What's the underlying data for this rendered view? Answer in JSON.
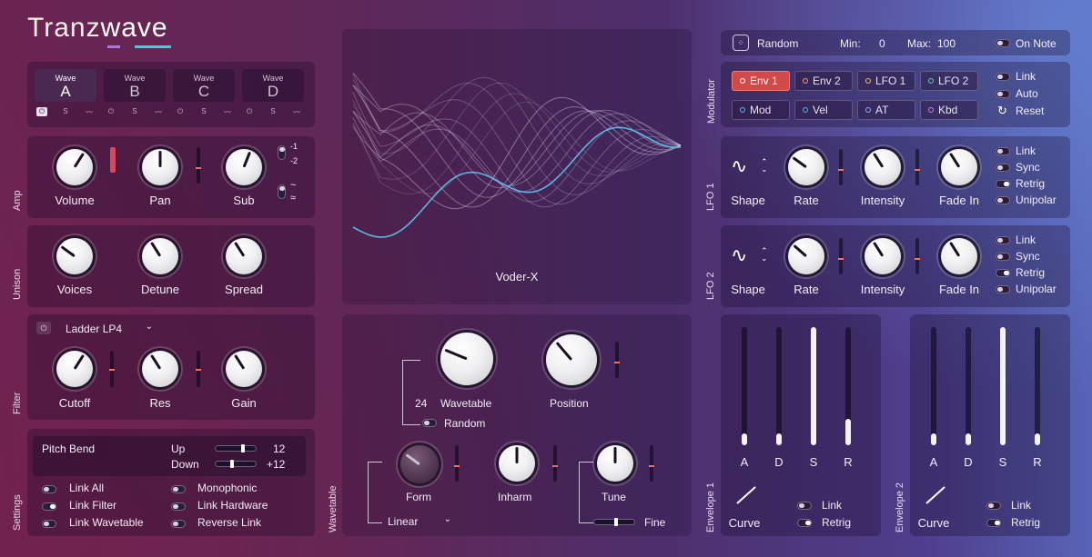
{
  "logo": {
    "part1": "Tranz",
    "part2": "wave"
  },
  "waves": {
    "title": "Wave",
    "items": [
      {
        "letter": "A",
        "active": true
      },
      {
        "letter": "B",
        "active": false
      },
      {
        "letter": "C",
        "active": false
      },
      {
        "letter": "D",
        "active": false
      }
    ],
    "icons": [
      "power-icon",
      "solo-icon",
      "waveform-icon"
    ],
    "solo_label": "S"
  },
  "amp": {
    "section": "Amp",
    "knobs": [
      {
        "label": "Volume",
        "value": 0.62
      },
      {
        "label": "Pan",
        "value": 0.5
      },
      {
        "label": "Sub",
        "value": 0.58
      }
    ],
    "octave_options": [
      "-1",
      "-2"
    ],
    "wave_options": [
      "~",
      "≈"
    ]
  },
  "unison": {
    "section": "Unison",
    "knobs": [
      {
        "label": "Voices",
        "value": 0.3
      },
      {
        "label": "Detune",
        "value": 0.38
      },
      {
        "label": "Spread",
        "value": 0.38
      }
    ]
  },
  "filter": {
    "section": "Filter",
    "type": "Ladder LP4",
    "knobs": [
      {
        "label": "Cutoff",
        "value": 0.62
      },
      {
        "label": "Res",
        "value": 0.38
      },
      {
        "label": "Gain",
        "value": 0.38
      }
    ]
  },
  "settings": {
    "section": "Settings",
    "pitch_bend": "Pitch Bend",
    "up_label": "Up",
    "up_value": "12",
    "down_label": "Down",
    "down_value": "+12",
    "toggles_left": [
      "Link All",
      "Link Filter",
      "Link Wavetable"
    ],
    "toggles_right": [
      "Monophonic",
      "Link Hardware",
      "Reverse Link"
    ],
    "left_on": [
      false,
      true,
      false
    ],
    "right_on": [
      false,
      false,
      false
    ]
  },
  "display": {
    "name": "Voder-X"
  },
  "wavetable": {
    "section": "Wavetable",
    "count": "24",
    "wavetable_label": "Wavetable",
    "position_label": "Position",
    "random_label": "Random",
    "form_label": "Form",
    "inharm_label": "Inharm",
    "tune_label": "Tune",
    "fine_label": "Fine",
    "form_type": "Linear"
  },
  "random_bar": {
    "label": "Random",
    "min_label": "Min:",
    "min_value": "0",
    "max_label": "Max:",
    "max_value": "100",
    "on_note": "On Note"
  },
  "modulator": {
    "section": "Modulator",
    "buttons": [
      {
        "label": "Env 1",
        "color": "#ff7a6a",
        "active": true
      },
      {
        "label": "Env 2",
        "color": "#ff9a7a",
        "active": false
      },
      {
        "label": "LFO 1",
        "color": "#f0c060",
        "active": false
      },
      {
        "label": "LFO 2",
        "color": "#50d8b0",
        "active": false
      },
      {
        "label": "Mod",
        "color": "#50c8e8",
        "active": false
      },
      {
        "label": "Vel",
        "color": "#50b8f0",
        "active": false
      },
      {
        "label": "AT",
        "color": "#8ab0ff",
        "active": false
      },
      {
        "label": "Kbd",
        "color": "#d880e8",
        "active": false
      }
    ],
    "link": "Link",
    "auto": "Auto",
    "reset": "Reset"
  },
  "lfo1": {
    "section": "LFO 1",
    "shape": "Shape",
    "knobs": [
      {
        "label": "Rate",
        "value": 0.3
      },
      {
        "label": "Intensity",
        "value": 0.38
      },
      {
        "label": "Fade In",
        "value": 0.38
      }
    ],
    "toggles": [
      "Link",
      "Sync",
      "Retrig",
      "Unipolar"
    ],
    "toggles_on": [
      false,
      false,
      true,
      false
    ]
  },
  "lfo2": {
    "section": "LFO 2",
    "shape": "Shape",
    "knobs": [
      {
        "label": "Rate",
        "value": 0.32
      },
      {
        "label": "Intensity",
        "value": 0.38
      },
      {
        "label": "Fade In",
        "value": 0.38
      }
    ],
    "toggles": [
      "Link",
      "Sync",
      "Retrig",
      "Unipolar"
    ],
    "toggles_on": [
      false,
      false,
      true,
      false
    ]
  },
  "env1": {
    "section": "Envelope 1",
    "stages": [
      {
        "label": "A",
        "level": 0.1
      },
      {
        "label": "D",
        "level": 0.1
      },
      {
        "label": "S",
        "level": 1.0
      },
      {
        "label": "R",
        "level": 0.22
      }
    ],
    "curve": "Curve",
    "link": "Link",
    "retrig": "Retrig"
  },
  "env2": {
    "section": "Envelope 2",
    "stages": [
      {
        "label": "A",
        "level": 0.1
      },
      {
        "label": "D",
        "level": 0.1
      },
      {
        "label": "S",
        "level": 1.0
      },
      {
        "label": "R",
        "level": 0.1
      }
    ],
    "curve": "Curve",
    "link": "Link",
    "retrig": "Retrig"
  }
}
